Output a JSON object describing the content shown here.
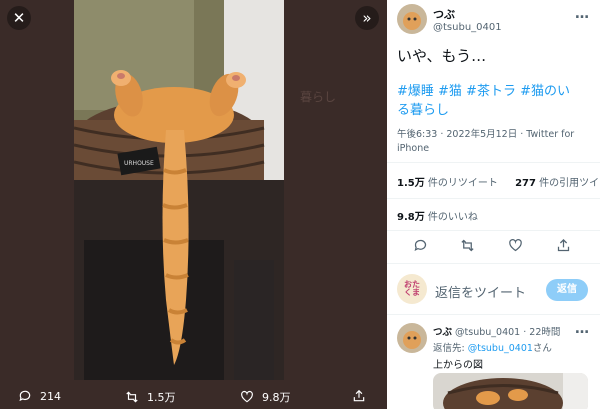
{
  "media": {
    "close_icon": "close-icon",
    "expand_icon": "chevrons-right-icon",
    "actions": {
      "replies": "214",
      "retweets": "1.5万",
      "likes": "9.8万"
    },
    "photo_labels": {
      "basket_tag": "URHOUSE",
      "background_text": "暮らし"
    }
  },
  "tweet": {
    "user_name": "つぶ",
    "user_handle": "@tsubu_0401",
    "text": "いや、もう…",
    "hashtags_line1": "#爆睡 #猫 #茶トラ #猫のい",
    "hashtags_line2": "る暮らし",
    "meta_line1": "午後6:33 · 2022年5月12日 · Twitter for",
    "meta_line2": "iPhone",
    "stats": {
      "retweets_value": "1.5万",
      "retweets_label": "件のリツイート",
      "quotes_value": "277",
      "quotes_label": "件の引用ツイート",
      "likes_value": "9.8万",
      "likes_label": "件のいいね"
    }
  },
  "reply_box": {
    "avatar_text": "おたくま",
    "placeholder": "返信をツイート",
    "button_label": "返信"
  },
  "reply": {
    "user_name": "つぶ",
    "user_handle": "@tsubu_0401",
    "time": "· 22時間",
    "reply_to_prefix": "返信先: ",
    "reply_to_handle": "@tsubu_0401",
    "reply_to_suffix": "さん",
    "text": "上からの図"
  },
  "colors": {
    "accent": "#1d9bf0",
    "media_bg": "#3a2b28"
  }
}
